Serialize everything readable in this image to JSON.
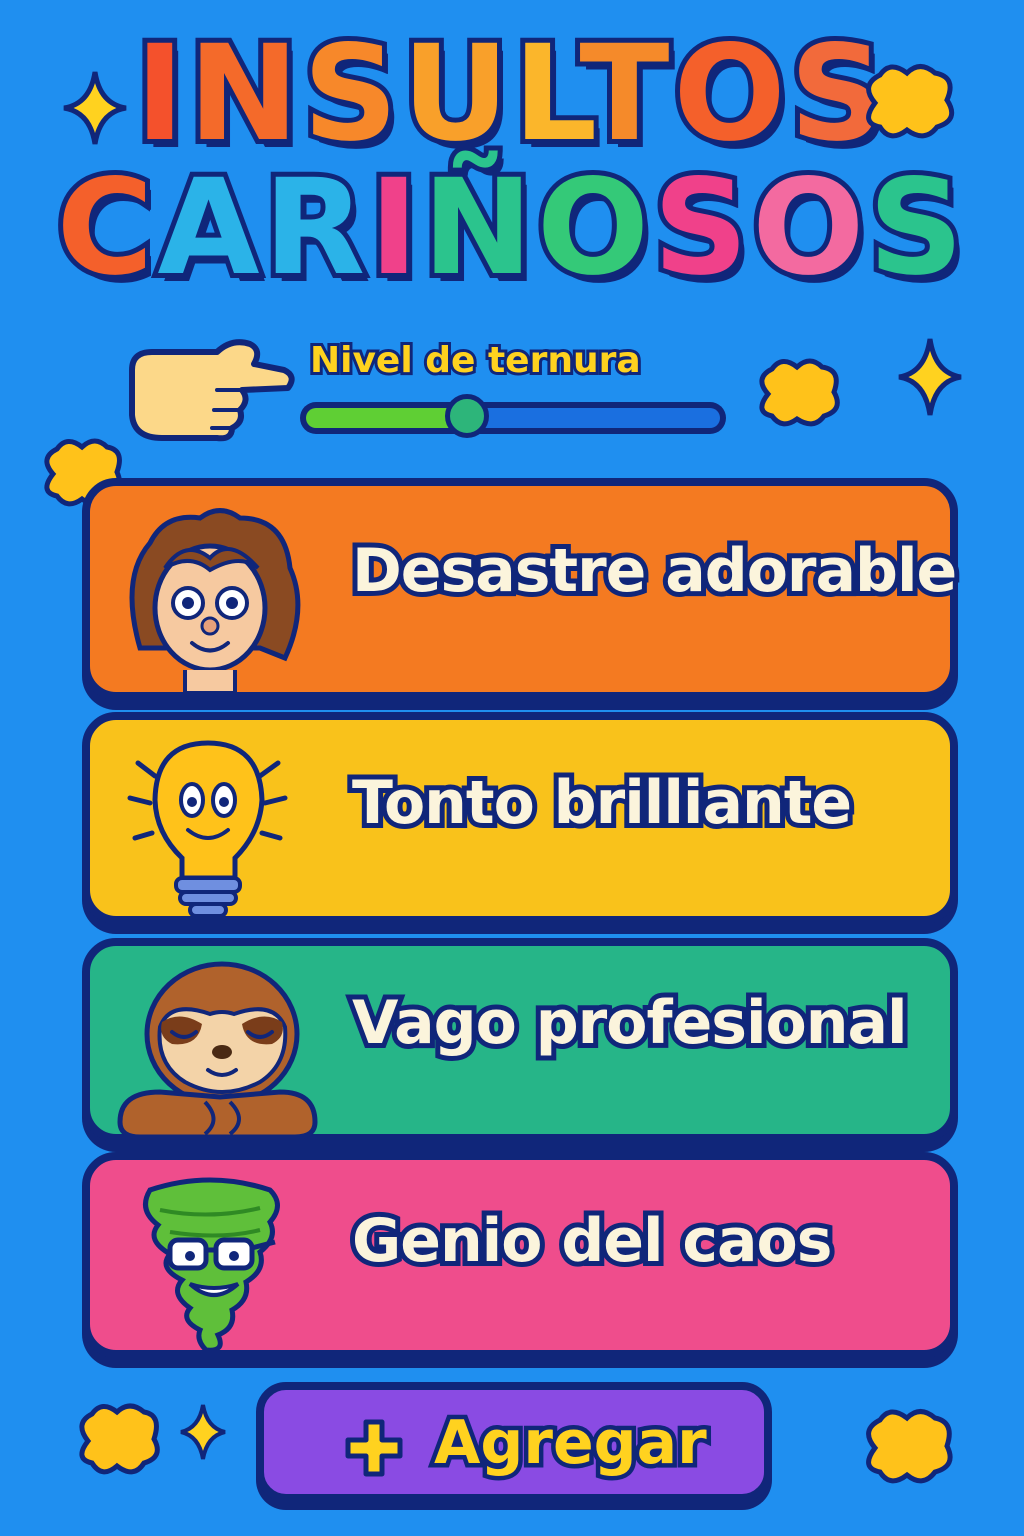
{
  "title": {
    "line1": [
      "I",
      "N",
      "S",
      "U",
      "L",
      "T",
      "O",
      "S"
    ],
    "line2": [
      "C",
      "A",
      "R",
      "I",
      "Ñ",
      "O",
      "S",
      "O",
      "S"
    ],
    "line1_colors": [
      "#f4512c",
      "#f46a2a",
      "#f7882a",
      "#f9a02a",
      "#fbb62b",
      "#f58a2a",
      "#f4602b",
      "#f26a3b"
    ],
    "line2_colors": [
      "#f4602b",
      "#2bb3e8",
      "#2bb3e8",
      "#f0418a",
      "#2bc48d",
      "#34c978",
      "#f0418a",
      "#f36aa0",
      "#2bc48d"
    ]
  },
  "slider": {
    "label": "Nivel de ternura",
    "value": 0.39
  },
  "cards": [
    {
      "label": "Desastre adorable",
      "color": "#f47a21",
      "icon": "messy-hair-kid-icon"
    },
    {
      "label": "Tonto brilliante",
      "color": "#f9c21b",
      "icon": "smiling-lightbulb-icon"
    },
    {
      "label": "Vago profesional",
      "color": "#26b588",
      "icon": "sleeping-sloth-icon"
    },
    {
      "label": "Genio del caos",
      "color": "#ef4d8c",
      "icon": "tornado-with-glasses-icon"
    }
  ],
  "add_button": {
    "label": "Agregar",
    "icon": "plus-icon",
    "color": "#8a4be3"
  },
  "colors": {
    "background": "#1f8ff0",
    "outline": "#10267a",
    "accent_yellow": "#ffd21f"
  }
}
